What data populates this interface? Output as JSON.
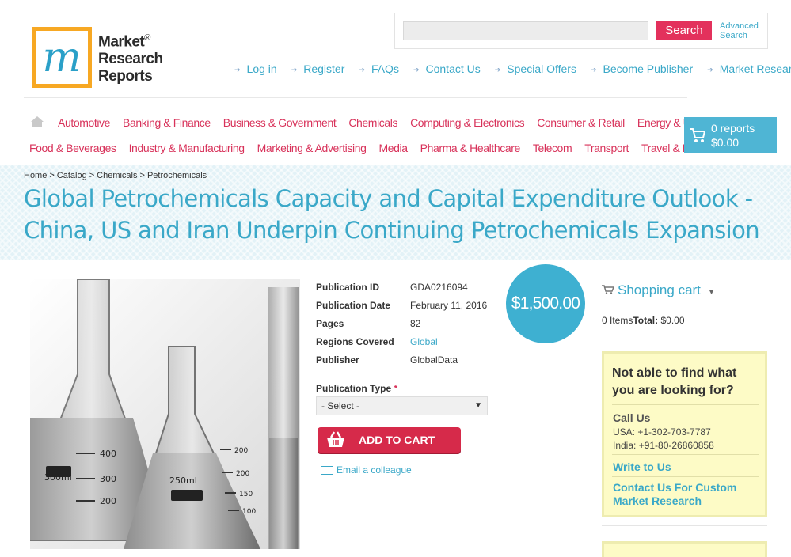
{
  "logo": {
    "mark": "m",
    "line1": "Market",
    "line2": "Research",
    "line3": "Reports",
    "reg": "®"
  },
  "search": {
    "placeholder": "",
    "button": "Search",
    "advanced_line1": "Advanced",
    "advanced_line2": "Search"
  },
  "top_links": [
    "Log in",
    "Register",
    "FAQs",
    "Contact Us",
    "Special Offers",
    "Become Publisher",
    "Market Research Blog"
  ],
  "nav": {
    "row1": [
      "Automotive",
      "Banking & Finance",
      "Business & Government",
      "Chemicals",
      "Computing & Electronics",
      "Consumer & Retail",
      "Energy & Utilities"
    ],
    "row2": [
      "Food & Beverages",
      "Industry & Manufacturing",
      "Marketing & Advertising",
      "Media",
      "Pharma & Healthcare",
      "Telecom",
      "Transport",
      "Travel & Leisure"
    ]
  },
  "cart_top": {
    "reports": "0 reports",
    "total": "$0.00"
  },
  "breadcrumb": [
    "Home",
    "Catalog",
    "Chemicals",
    "Petrochemicals"
  ],
  "breadcrumb_sep": ">",
  "title": "Global Petrochemicals Capacity and Capital Expenditure Outlook - China, US and Iran Underpin Continuing Petrochemicals Expansion",
  "details": [
    {
      "label": "Publication ID",
      "value": "GDA0216094"
    },
    {
      "label": "Publication Date",
      "value": "February 11, 2016"
    },
    {
      "label": "Pages",
      "value": "82"
    },
    {
      "label": "Regions Covered",
      "value": "Global"
    },
    {
      "label": "Publisher",
      "value": "GlobalData"
    }
  ],
  "image_labels": {
    "flask1": "300ml",
    "flask1_marks": [
      "400",
      "300",
      "200"
    ],
    "flask2": "250ml",
    "flask2_marks": [
      "200",
      "200",
      "150",
      "100"
    ]
  },
  "price": "$1,500.00",
  "publication_type": {
    "label": "Publication Type",
    "required": "*",
    "selected": "- Select -"
  },
  "add_to_cart": "ADD TO CART",
  "email_colleague": "Email a colleague",
  "sidebar": {
    "cart_title": "Shopping cart",
    "items": "0 Items",
    "total_label": "Total:",
    "total_value": "$0.00",
    "help_question": "Not able to find what you are looking for?",
    "call_us": "Call Us",
    "phone_usa": "USA: +1-302-703-7787",
    "phone_india": "India: +91-80-26860858",
    "write_to_us": "Write to Us",
    "custom_research": "Contact Us For Custom Market Research"
  },
  "colors": {
    "accent": "#3aa8c8",
    "nav": "#d8325a",
    "cart_button": "#d62a4a",
    "logo_orange": "#f7a823",
    "help_bg": "#fdfbc6"
  }
}
